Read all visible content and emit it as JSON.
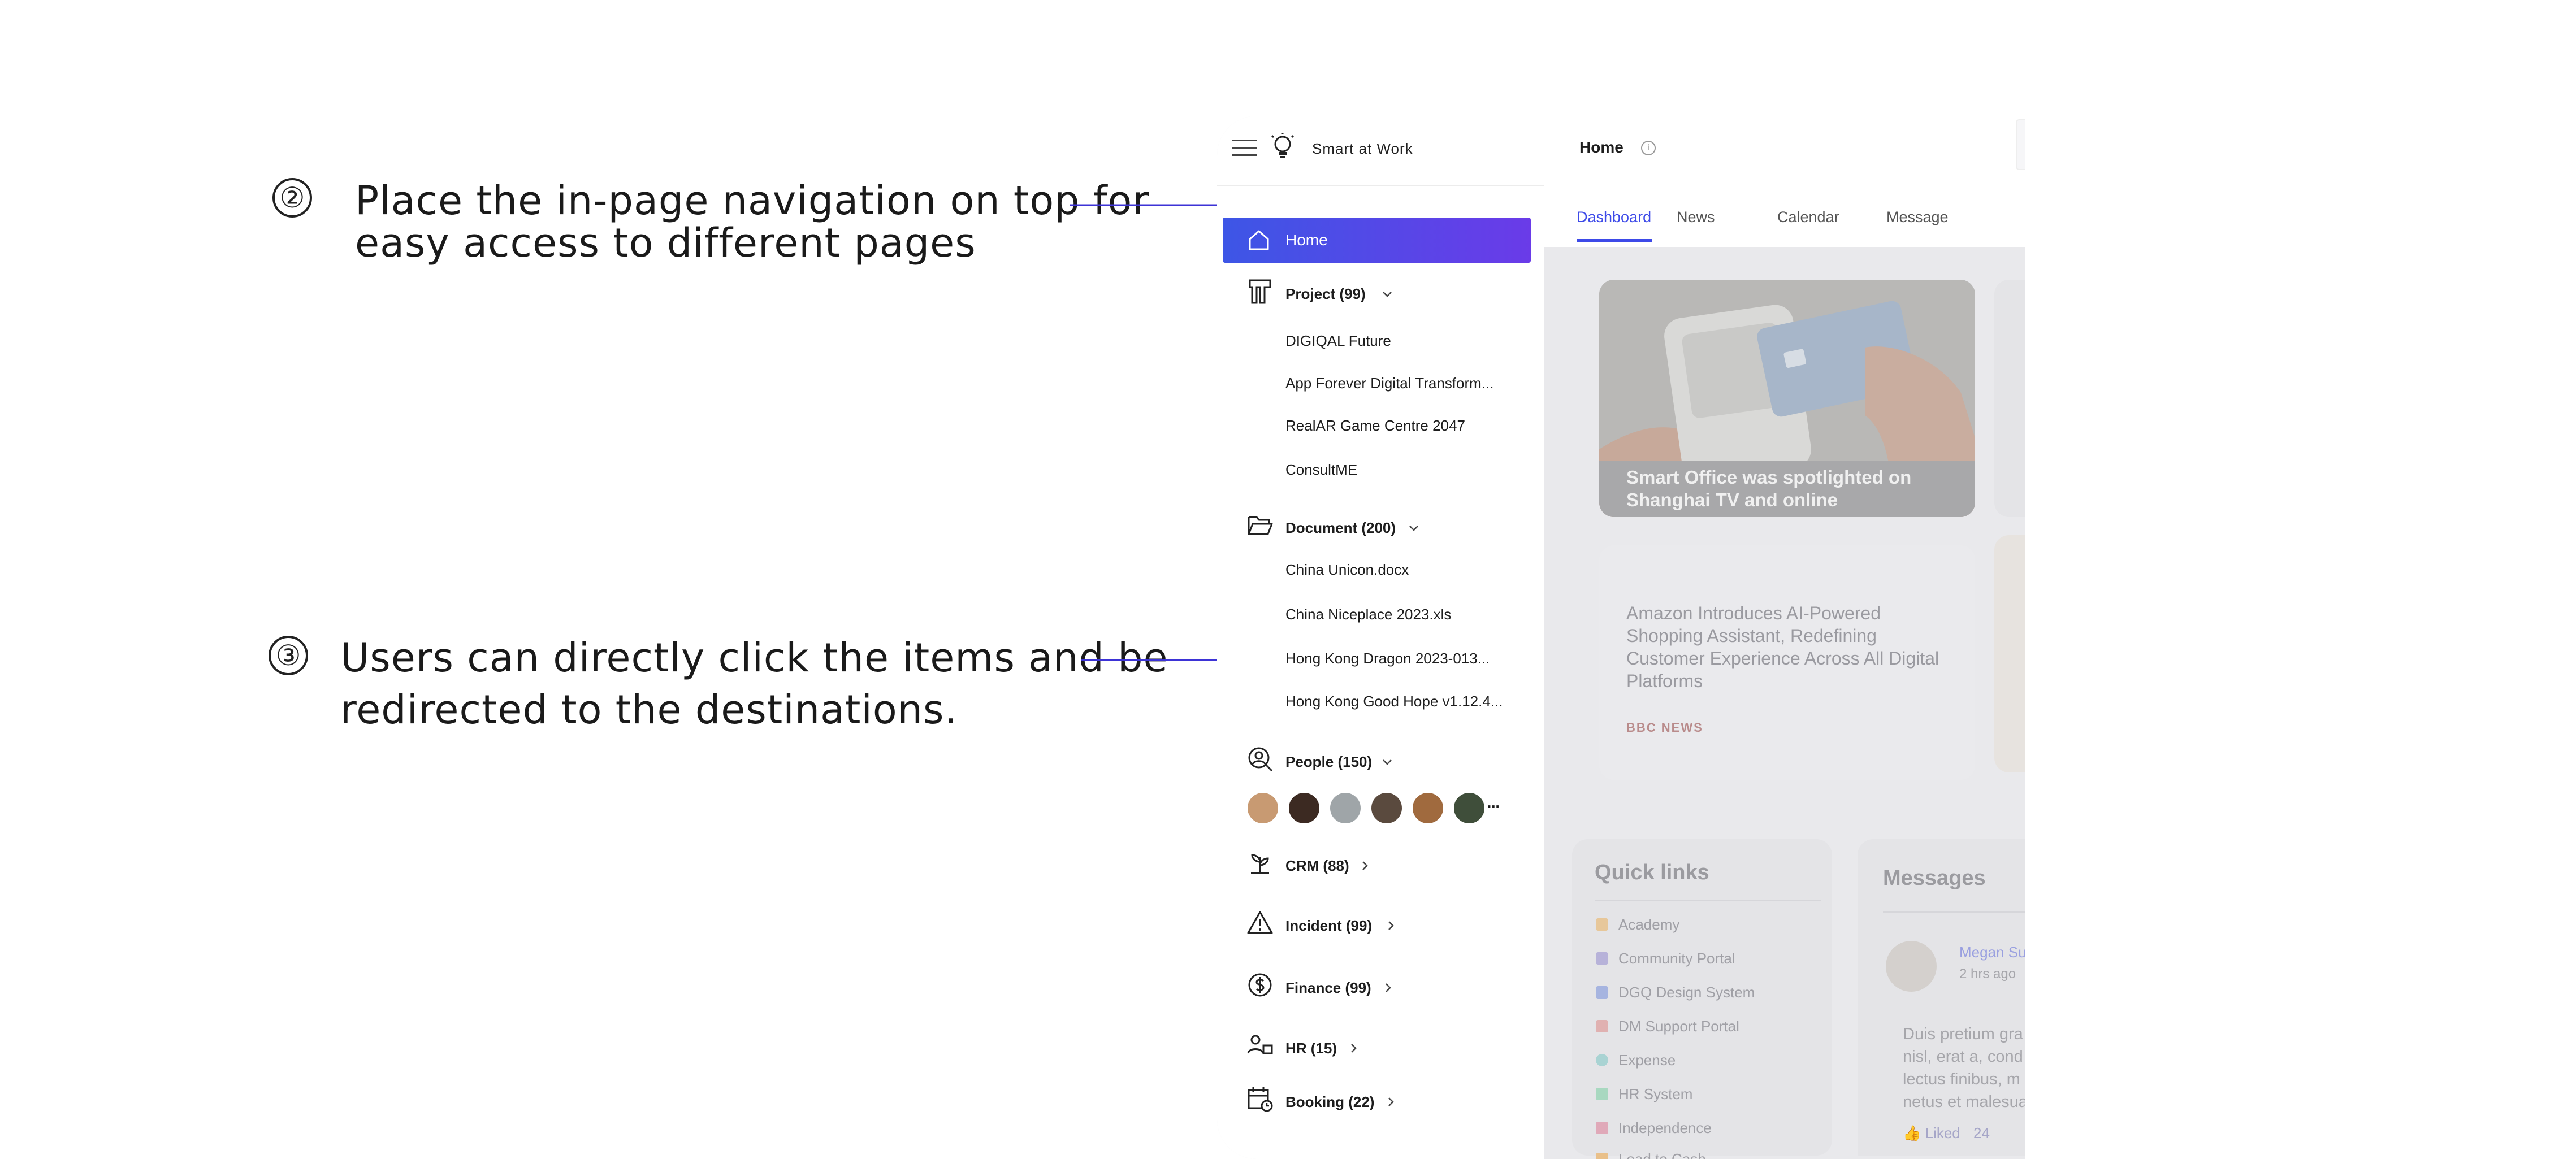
{
  "annotations": {
    "step2": {
      "number": "②",
      "line1": "Place the in-page navigation on top for",
      "line2": "easy access to different pages"
    },
    "step3": {
      "number": "③",
      "line1": "Users can directly click the items and be",
      "line2": "redirected to the destinations."
    },
    "arrow_color": "#3d33d6"
  },
  "app": {
    "brand": "Smart at Work",
    "page_title": "Home"
  },
  "tabs": [
    {
      "label": "Dashboard",
      "active": true
    },
    {
      "label": "News",
      "active": false
    },
    {
      "label": "Calendar",
      "active": false
    },
    {
      "label": "Message",
      "active": false
    }
  ],
  "sidebar": {
    "home": "Home",
    "project": {
      "title": "Project (99)",
      "items": [
        "DIGIQAL Future",
        "App Forever Digital Transform...",
        "RealAR Game Centre 2047",
        "ConsultME"
      ]
    },
    "document": {
      "title": "Document (200)",
      "items": [
        "China Unicon.docx",
        "China Niceplace 2023.xls",
        "Hong Kong Dragon 2023-013...",
        "Hong Kong Good Hope v1.12.4..."
      ]
    },
    "people": {
      "title": "People (150)",
      "more": "..."
    },
    "crm": "CRM (88)",
    "incident": "Incident (99)",
    "finance": "Finance (99)",
    "hr": "HR (15)",
    "booking": "Booking (22)"
  },
  "dashboard": {
    "news_caption": "Smart Office was spotlighted on Shanghai TV and online",
    "article": "Amazon Introduces AI-Powered Shopping Assistant, Redefining Customer Experience Across All Digital Platforms",
    "article_source": "BBC NEWS",
    "quick_links": {
      "title": "Quick links",
      "items": [
        "Academy",
        "Community Portal",
        "DGQ Design System",
        "DM Support Portal",
        "Expense",
        "HR System",
        "Independence",
        "Lead to Cash"
      ]
    },
    "messages": {
      "title": "Messages",
      "author": "Megan Su",
      "time": "2 hrs ago",
      "body": [
        "Duis pretium gra",
        "nisl, erat a, cond",
        "lectus finibus, m",
        "netus et malesua"
      ],
      "liked_label": "Liked",
      "liked_count": "24"
    }
  },
  "colors": {
    "accent": "#3d4ae8",
    "home_gradient_start": "#3d56e6",
    "home_gradient_end": "#6a3be8"
  }
}
